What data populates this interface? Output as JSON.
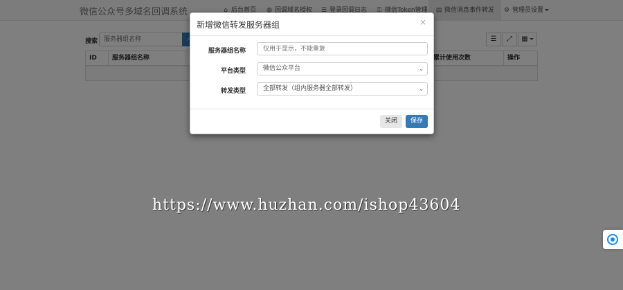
{
  "navbar": {
    "brand": "微信公众号多域名回调系统",
    "items": [
      {
        "label": "后台首页",
        "icon": "home-icon",
        "glyph": "⌂"
      },
      {
        "label": "回调域名授权",
        "icon": "globe-icon",
        "glyph": "◍"
      },
      {
        "label": "登录回调日志",
        "icon": "list-icon",
        "glyph": "☰"
      },
      {
        "label": "微信Token管理",
        "icon": "key-icon",
        "glyph": "⚿"
      },
      {
        "label": "微信消息事件转发",
        "icon": "forward-icon",
        "glyph": "▤"
      },
      {
        "label": "管理员设置",
        "icon": "gear-icon",
        "glyph": "⚙"
      }
    ]
  },
  "search": {
    "label": "搜索",
    "placeholder": "服务器组名称"
  },
  "table": {
    "columns": [
      "ID",
      "服务器组名称",
      "",
      "累计使用次数",
      "操作"
    ]
  },
  "modal": {
    "title": "新增微信转发服务器组",
    "close_glyph": "×",
    "fields": [
      {
        "label": "服务器组名称",
        "value": "",
        "placeholder": "仅用于显示，不能重复"
      },
      {
        "label": "平台类型",
        "value": "微信公众平台"
      },
      {
        "label": "转发类型",
        "value": "全部转发（组内服务器全部转发）"
      }
    ],
    "buttons": {
      "close": "关闭",
      "save": "保存"
    }
  },
  "watermark": "https://www.huzhan.com/ishop43604",
  "colors": {
    "primary": "#337ab7",
    "backdrop": "rgba(0,0,0,0.5)"
  }
}
